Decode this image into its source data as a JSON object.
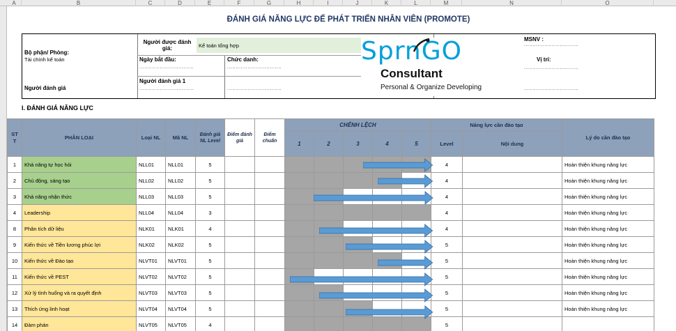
{
  "columns": [
    "A",
    "B",
    "C",
    "D",
    "E",
    "F",
    "G",
    "H",
    "I",
    "J",
    "K",
    "L",
    "M",
    "N",
    "O"
  ],
  "title": "ĐÁNH GIÁ NĂNG LỰC ĐỂ PHÁT TRIỂN NHÂN VIÊN (PROMOTE)",
  "info": {
    "dept_label": "Bộ phận/ Phòng:",
    "dept_value": "Tài chính kế toán",
    "evaluated_label": "Người được đánh giá:",
    "evaluated_value": "Kế toán tổng hợp",
    "msnv_label": "MSNV :",
    "start_label": "Ngày bắt đầu:",
    "position_label": "Chức danh:",
    "role_label": "Vị trí:",
    "evaluator_label": "Người đánh giá",
    "evaluator1_label": "Người đánh giá 1",
    "dots": "................................"
  },
  "logo": {
    "brand_a": "Spr",
    "brand_b": "n",
    "brand_c": "GO",
    "line2": "Consultant",
    "line3": "Personal & Organize Developing"
  },
  "section_title": "I. ĐÁNH GIÁ NĂNG LỰC",
  "table": {
    "headers": {
      "stt": "STT",
      "category": "PHÂN LOẠI",
      "type": "Loại NL",
      "code": "Mã NL",
      "required": "Đánh giá NL Level",
      "score": "Điểm đánh giá",
      "standard": "Điểm chuẩn",
      "gap": "CHÊNH LỆCH",
      "gap_levels": [
        "1",
        "2",
        "3",
        "4",
        "5"
      ],
      "training": "Năng lực cần đào tạo",
      "level": "Level",
      "content": "Nội dung",
      "reason": "Lý do cần đào tạo"
    },
    "rows": [
      {
        "stt": "1",
        "name": "Khả năng tự học hỏi",
        "type": "NLL01",
        "code": "NLL01",
        "required": "5",
        "level": "4",
        "reason": "Hoàn thiện khung năng lực",
        "color": "g",
        "gray_from": 1,
        "gray_to": 5,
        "arrow_from": 3.7,
        "arrow_to": 5.0
      },
      {
        "stt": "2",
        "name": "Chủ động, sáng tạo",
        "type": "NLL02",
        "code": "NLL02",
        "required": "5",
        "level": "4",
        "reason": "Hoàn thiện khung năng lực",
        "color": "g",
        "gray_from": 1,
        "gray_to": 4,
        "arrow_from": 4.2,
        "arrow_to": 5.0
      },
      {
        "stt": "3",
        "name": "Khả năng nhận thức",
        "type": "NLL03",
        "code": "NLL03",
        "required": "5",
        "level": "4",
        "reason": "Hoàn thiện khung năng lực",
        "color": "g",
        "gray_from": 1,
        "gray_to": 2,
        "arrow_from": 2.0,
        "arrow_to": 5.0
      },
      {
        "stt": "4",
        "name": "Leadership",
        "type": "NLL04",
        "code": "NLL04",
        "required": "3",
        "level": "4",
        "reason": "Hoàn thiện khung năng lực",
        "color": "y",
        "gray_from": 1,
        "gray_to": 5,
        "arrow_from": null,
        "arrow_to": null
      },
      {
        "stt": "8",
        "name": "Phân tích dữ liệu",
        "type": "NLK01",
        "code": "NLK01",
        "required": "4",
        "level": "4",
        "reason": "Hoàn thiện khung năng lực",
        "color": "y",
        "gray_from": 1,
        "gray_to": 2,
        "arrow_from": 2.2,
        "arrow_to": 5.0
      },
      {
        "stt": "9",
        "name": "Kiến thức về Tiền lương phúc lợi",
        "type": "NLK02",
        "code": "NLK02",
        "required": "5",
        "level": "5",
        "reason": "Hoàn thiện khung năng lực",
        "color": "y",
        "gray_from": 1,
        "gray_to": 3,
        "arrow_from": 3.1,
        "arrow_to": 5.0
      },
      {
        "stt": "10",
        "name": "Kiến thức về Đào tạo",
        "type": "NLVT01",
        "code": "NLVT01",
        "required": "5",
        "level": "5",
        "reason": "Hoàn thiện khung năng lực",
        "color": "y",
        "gray_from": 1,
        "gray_to": 4,
        "arrow_from": 4.2,
        "arrow_to": 5.0
      },
      {
        "stt": "11",
        "name": "Kiến thức về PEST",
        "type": "NLVT02",
        "code": "NLVT02",
        "required": "5",
        "level": "5",
        "reason": "Hoàn thiện khung năng lực",
        "color": "y",
        "gray_from": 1,
        "gray_to": 1,
        "arrow_from": 1.2,
        "arrow_to": 5.0
      },
      {
        "stt": "12",
        "name": "Xử lý tình huống và ra quyết định",
        "type": "NLVT03",
        "code": "NLVT03",
        "required": "5",
        "level": "5",
        "reason": "Hoàn thiện khung năng lực",
        "color": "y",
        "gray_from": 1,
        "gray_to": 2,
        "arrow_from": 2.2,
        "arrow_to": 5.0
      },
      {
        "stt": "13",
        "name": "Thích ứng linh hoạt",
        "type": "NLVT04",
        "code": "NLVT04",
        "required": "5",
        "level": "5",
        "reason": "Hoàn thiện khung năng lực",
        "color": "y",
        "gray_from": 1,
        "gray_to": 3,
        "arrow_from": 3.1,
        "arrow_to": 5.0
      },
      {
        "stt": "14",
        "name": "Đàm phán",
        "type": "NLVT05",
        "code": "NLVT05",
        "required": "4",
        "level": "5",
        "reason": "",
        "color": "y",
        "gray_from": 1,
        "gray_to": 5,
        "arrow_from": null,
        "arrow_to": null
      }
    ]
  },
  "colors": {
    "header_blue": "#8da1bb",
    "green": "#a8d08d",
    "yellow": "#ffe699",
    "gray": "#a6a6a6",
    "arrow": "#5b9bd5",
    "title": "#1f3864"
  }
}
